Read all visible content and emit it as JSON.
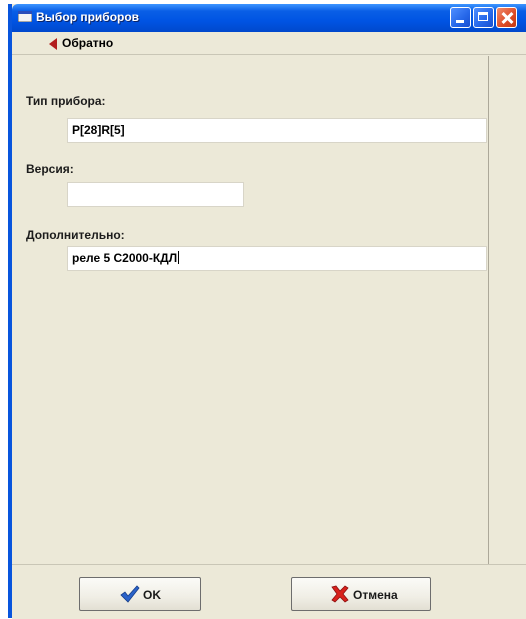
{
  "window": {
    "title": "Выбор приборов",
    "colors": {
      "titlebar": "#0054e3",
      "close": "#dd4a26",
      "face": "#ece9d8"
    }
  },
  "toolbar": {
    "back_label": "Обратно"
  },
  "form": {
    "type": {
      "label": "Тип прибора:",
      "value": "Р[28]R[5]"
    },
    "version": {
      "label": "Версия:",
      "value": ""
    },
    "extra": {
      "label": "Дополнительно:",
      "value": "реле 5 С2000-КДЛ"
    }
  },
  "buttons": {
    "ok_label": "OK",
    "cancel_label": "Отмена"
  },
  "icons": {
    "window": "window-icon",
    "back": "back-arrow-icon",
    "ok": "checkmark-icon",
    "cancel": "red-x-icon"
  }
}
